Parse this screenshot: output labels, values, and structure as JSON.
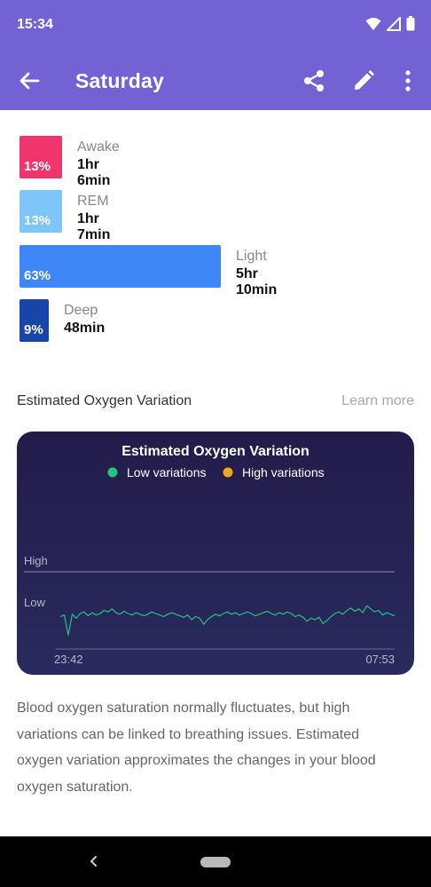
{
  "status_bar": {
    "time": "15:34"
  },
  "app_bar": {
    "title": "Saturday",
    "back_icon": "arrow-left-icon",
    "share_icon": "share-icon",
    "edit_icon": "pencil-icon",
    "more_icon": "more-vertical-icon"
  },
  "sleep_stages": [
    {
      "name": "Awake",
      "percent": "13%",
      "duration": "1hr 6min",
      "color": "#f0356d"
    },
    {
      "name": "REM",
      "percent": "13%",
      "duration": "1hr 7min",
      "color": "#7ec6fa"
    },
    {
      "name": "Light",
      "percent": "63%",
      "duration": "5hr 10min",
      "color": "#3f87f6"
    },
    {
      "name": "Deep",
      "percent": "9%",
      "duration": "48min",
      "color": "#1746a8"
    }
  ],
  "oxygen_section": {
    "title": "Estimated Oxygen Variation",
    "learn_more": "Learn more",
    "description": "Blood oxygen saturation normally fluctuates, but high variations can be linked to breathing issues. Estimated oxygen variation approximates the changes in your blood oxygen saturation."
  },
  "chart_data": {
    "type": "line",
    "title": "Estimated Oxygen Variation",
    "legend": [
      {
        "label": "Low variations",
        "color": "#27c281"
      },
      {
        "label": "High variations",
        "color": "#f4a622"
      }
    ],
    "legend_placement": "top-center",
    "y_levels": [
      "High",
      "Low"
    ],
    "x_tick_labels": [
      "23:42",
      "07:53"
    ],
    "ylim": [
      0,
      1
    ],
    "series": [
      {
        "values": [
          0.42,
          0.44,
          0.18,
          0.45,
          0.4,
          0.46,
          0.48,
          0.43,
          0.47,
          0.44,
          0.46,
          0.5,
          0.48,
          0.52,
          0.47,
          0.45,
          0.49,
          0.46,
          0.44,
          0.47,
          0.45,
          0.43,
          0.45,
          0.48,
          0.46,
          0.44,
          0.42,
          0.45,
          0.47,
          0.45,
          0.43,
          0.41,
          0.44,
          0.38,
          0.42,
          0.4,
          0.32,
          0.38,
          0.42,
          0.45,
          0.43,
          0.46,
          0.48,
          0.45,
          0.47,
          0.44,
          0.46,
          0.48,
          0.46,
          0.43,
          0.45,
          0.47,
          0.49,
          0.46,
          0.44,
          0.47,
          0.45,
          0.48,
          0.46,
          0.42,
          0.44,
          0.41,
          0.36,
          0.4,
          0.38,
          0.41,
          0.33,
          0.37,
          0.42,
          0.46,
          0.48,
          0.45,
          0.5,
          0.53,
          0.49,
          0.52,
          0.47,
          0.56,
          0.52,
          0.48,
          0.5,
          0.44,
          0.47,
          0.45,
          0.43
        ]
      }
    ]
  },
  "system_nav": {
    "back_icon": "nav-back-chevron-icon",
    "home_icon": "nav-home-pill-icon"
  }
}
